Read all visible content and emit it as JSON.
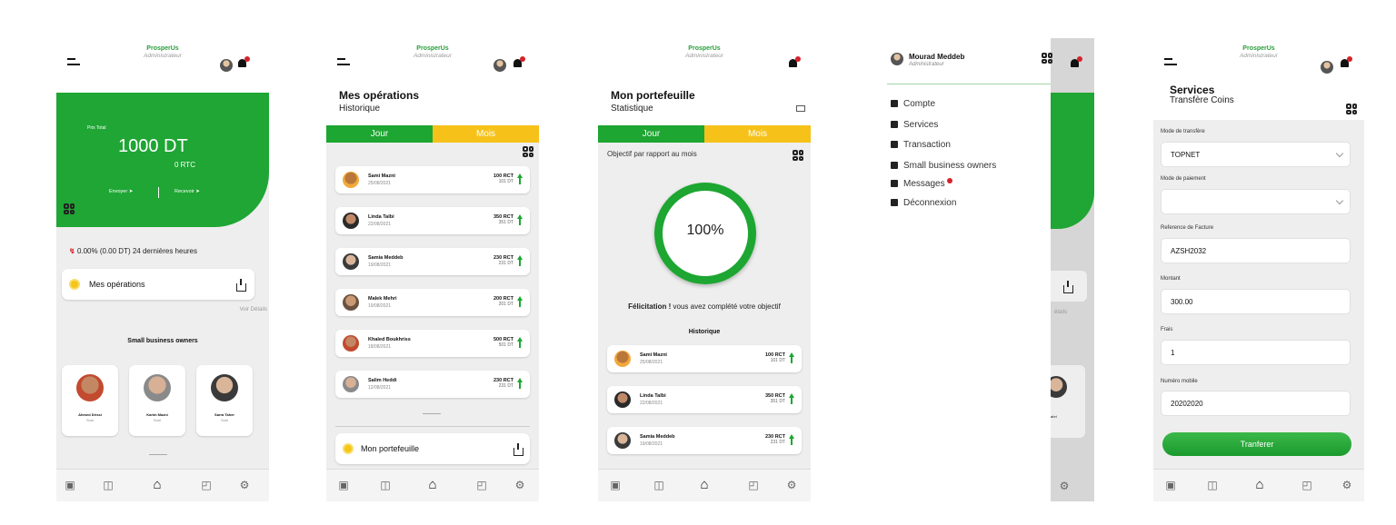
{
  "brand": {
    "name": "ProsperUs",
    "role": "Administrateur"
  },
  "screen1": {
    "total_label": "Prix Total",
    "total_value": "1000 DT",
    "total_rtc": "0 RTC",
    "send": "Envoyer",
    "receive": "Recevoir",
    "change": "0.00% (0.00 DT) 24 dernières heures",
    "ops_label": "Mes opérations",
    "see_details": "Voir Détails",
    "sbo_title": "Small business owners",
    "owners": [
      {
        "name": "Ahmed Drissi",
        "sub": "Suni"
      },
      {
        "name": "Karim Mazni",
        "sub": "Suni"
      },
      {
        "name": "Sarra Taher",
        "sub": "Suni"
      }
    ]
  },
  "screen2": {
    "title": "Mes opérations",
    "subtitle": "Historique",
    "tab_day": "Jour",
    "tab_month": "Mois",
    "rows": [
      {
        "name": "Sami Mazni",
        "date": "25/08/2021",
        "rct": "100 RCT",
        "dt": "101 DT"
      },
      {
        "name": "Linda Talbi",
        "date": "22/08/2021",
        "rct": "350 RCT",
        "dt": "351 DT"
      },
      {
        "name": "Samia Meddeb",
        "date": "19/08/2021",
        "rct": "230 RCT",
        "dt": "231 DT"
      },
      {
        "name": "Malek Mehri",
        "date": "19/08/2021",
        "rct": "200 RCT",
        "dt": "201 DT"
      },
      {
        "name": "Khaled Boukhriss",
        "date": "18/08/2021",
        "rct": "500 RCT",
        "dt": "501 DT"
      },
      {
        "name": "Salim Heddi",
        "date": "12/08/2021",
        "rct": "230 RCT",
        "dt": "231 DT"
      }
    ],
    "wallet_label": "Mon portefeuille"
  },
  "screen3": {
    "title": "Mon portefeuille",
    "subtitle": "Statistique",
    "tab_day": "Jour",
    "tab_month": "Mois",
    "objective": "Objectif par rapport au mois",
    "percent": "100%",
    "congrats_bold": "Félicitation !",
    "congrats_rest": " vous avez complété votre objectif",
    "history": "Historique",
    "rows": [
      {
        "name": "Sami Mazni",
        "date": "25/08/2021",
        "rct": "100 RCT",
        "dt": "101 DT"
      },
      {
        "name": "Linda Talbi",
        "date": "22/08/2021",
        "rct": "350 RCT",
        "dt": "351 DT"
      },
      {
        "name": "Samia Meddeb",
        "date": "19/08/2021",
        "rct": "230 RCT",
        "dt": "231 DT"
      }
    ]
  },
  "screen4": {
    "user": "Mourad Meddeb",
    "role": "Administrateur",
    "menu": [
      "Compte",
      "Services",
      "Transaction",
      "Small business owners",
      "Messages",
      "Déconnexion"
    ],
    "partial_details": "étails",
    "partial_owner": "ahri"
  },
  "screen5": {
    "title": "Services",
    "subtitle": "Transfère Coins",
    "fields": [
      {
        "label": "Mode de transfère",
        "value": "TOPNET",
        "select": true
      },
      {
        "label": "Mode de paiement",
        "value": "",
        "select": true
      },
      {
        "label": "Reference de Facture",
        "value": "AZSH2032",
        "select": false
      },
      {
        "label": "Montant",
        "value": "300.00",
        "select": false
      },
      {
        "label": "Frais",
        "value": "1",
        "select": false
      },
      {
        "label": "Numéro mobile",
        "value": "20202020",
        "select": false
      }
    ],
    "submit": "Tranferer"
  },
  "colors": {
    "green": "#1da631",
    "yellow": "#f6c21a",
    "red": "#d4222b"
  }
}
